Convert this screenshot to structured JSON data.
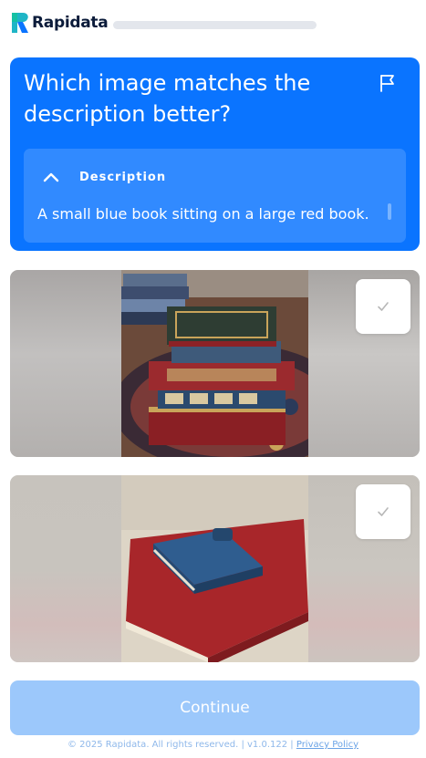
{
  "app": {
    "brand_name": "Rapidata",
    "progress": 0.0,
    "accent_color": "#0a74ff"
  },
  "question": {
    "title": "Which image matches the description better?",
    "flag_icon": "flag-icon",
    "description": {
      "label": "Description",
      "text": "A small blue book sitting on a large red book.",
      "expanded": true
    }
  },
  "options": [
    {
      "image": "stack of ornate antique books on a patterned rug",
      "selected": false
    },
    {
      "image": "small blue book lying on a large red book",
      "selected": false
    }
  ],
  "continue_button": {
    "label": "Continue",
    "enabled": false
  },
  "footer": {
    "copyright": "© 2025 Rapidata. All rights reserved.",
    "separator": "|",
    "version": "v1.0.122",
    "privacy_link": "Privacy Policy"
  }
}
